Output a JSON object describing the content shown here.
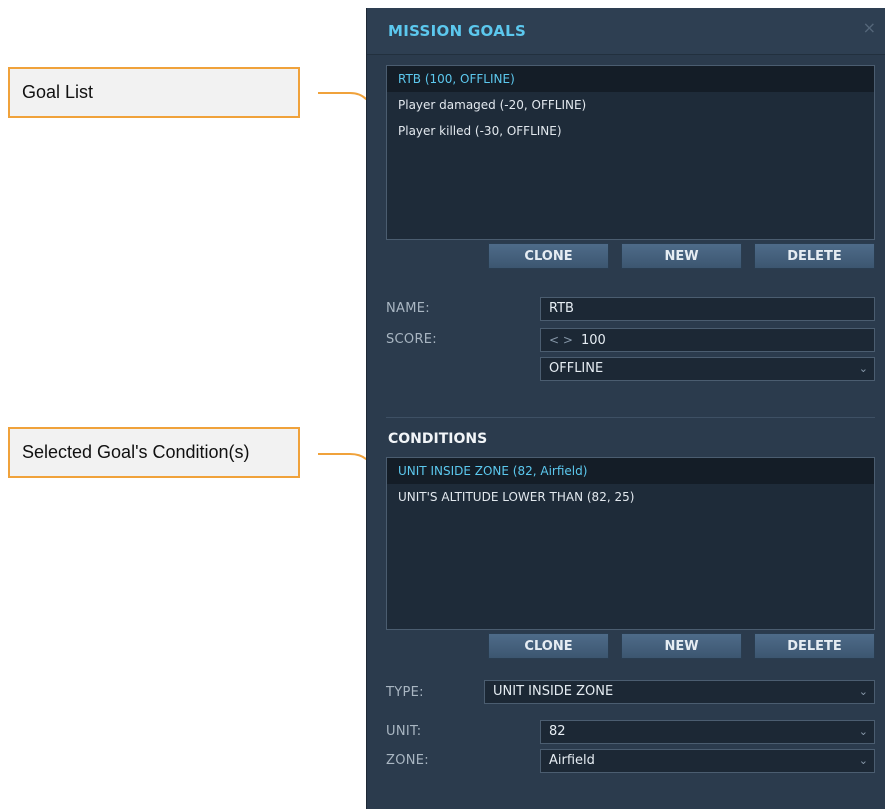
{
  "callouts": {
    "goal_list": "Goal List",
    "conditions": "Selected Goal's Condition(s)"
  },
  "colors": {
    "callout_border": "#f0a23b",
    "panel_bg": "#2b3b4d",
    "accent": "#5cc8ee",
    "button": "#4e6b89"
  },
  "panel": {
    "title": "MISSION GOALS",
    "close_icon": "×"
  },
  "goals": {
    "items": [
      {
        "label": "RTB (100, OFFLINE)",
        "selected": true
      },
      {
        "label": "Player damaged (-20, OFFLINE)",
        "selected": false
      },
      {
        "label": "Player killed (-30, OFFLINE)",
        "selected": false
      }
    ],
    "buttons": {
      "clone": "CLONE",
      "new": "NEW",
      "delete": "DELETE"
    }
  },
  "goal_form": {
    "name_label": "NAME:",
    "name_value": "RTB",
    "score_label": "SCORE:",
    "score_stepper": "< >",
    "score_value": "100",
    "mode_value": "OFFLINE"
  },
  "conditions": {
    "heading": "CONDITIONS",
    "items": [
      {
        "label": "UNIT INSIDE ZONE (82, Airfield)",
        "selected": true
      },
      {
        "label": "UNIT'S ALTITUDE LOWER THAN (82, 25)",
        "selected": false
      }
    ],
    "buttons": {
      "clone": "CLONE",
      "new": "NEW",
      "delete": "DELETE"
    }
  },
  "condition_form": {
    "type_label": "TYPE:",
    "type_value": "UNIT INSIDE ZONE",
    "unit_label": "UNIT:",
    "unit_value": "82",
    "zone_label": "ZONE:",
    "zone_value": "Airfield"
  },
  "icons": {
    "close": "close-icon",
    "dropdown": "chevron-down-icon",
    "stepper": "stepper-arrows-icon",
    "arrow": "callout-arrow-icon"
  }
}
